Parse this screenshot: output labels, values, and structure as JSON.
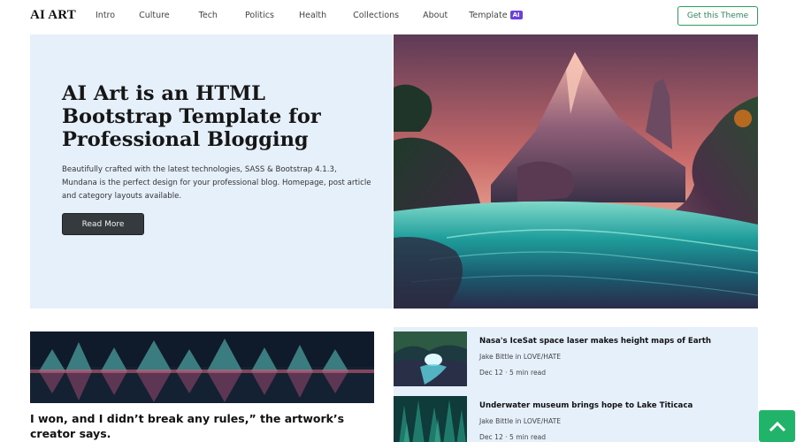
{
  "nav": {
    "brand": "AI ART",
    "items": [
      {
        "label": "Intro"
      },
      {
        "label": "Culture"
      },
      {
        "label": "Tech"
      },
      {
        "label": "Politics"
      },
      {
        "label": "Health"
      },
      {
        "label": "Collections"
      },
      {
        "label": "About"
      },
      {
        "label": "Template",
        "badge": "AI"
      }
    ],
    "cta_label": "Get this Theme"
  },
  "hero": {
    "title": "AI Art is an HTML Bootstrap Template for Professional Blogging",
    "description": "Beautifully crafted with the latest technologies, SASS & Bootstrap 4.1.3, Mundana is the perfect design for your professional blog. Homepage, post article and category layouts available.",
    "button_label": "Read More",
    "image_icon": "mountain-river-landscape"
  },
  "feature": {
    "title": "I won, and I didn’t break any rules,” the artwork’s creator says.",
    "image_icon": "forest-reflection"
  },
  "posts": [
    {
      "title": "Nasa's IceSat space laser makes height maps of Earth",
      "author": "Jake Bittle in LOVE/HATE",
      "meta": "Dec 12 · 5 min read",
      "image_icon": "glowing-cave-river"
    },
    {
      "title": "Underwater museum brings hope to Lake Titicaca",
      "author": "Jake Bittle in LOVE/HATE",
      "meta": "Dec 12 · 5 min read",
      "image_icon": "teal-forest"
    }
  ],
  "back_to_top_icon": "chevron-up-icon",
  "colors": {
    "accent_green": "#22b36b",
    "badge_purple": "#6c3fe0",
    "panel_bg": "#e6f0fb",
    "button_dark": "#353a3e"
  }
}
